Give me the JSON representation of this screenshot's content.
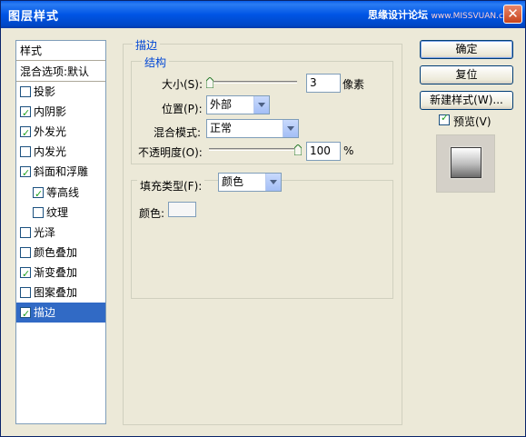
{
  "window": {
    "title": "图层样式",
    "watermark_cn": "思缘设计论坛",
    "watermark_en": "www.MISSVUAN.com",
    "close_glyph": "✕"
  },
  "style_list": {
    "header": "样式",
    "blend_options": "混合选项:默认",
    "items": [
      {
        "label": "投影",
        "checked": false,
        "indent": false,
        "selected": false
      },
      {
        "label": "内阴影",
        "checked": true,
        "indent": false,
        "selected": false
      },
      {
        "label": "外发光",
        "checked": true,
        "indent": false,
        "selected": false
      },
      {
        "label": "内发光",
        "checked": false,
        "indent": false,
        "selected": false
      },
      {
        "label": "斜面和浮雕",
        "checked": true,
        "indent": false,
        "selected": false
      },
      {
        "label": "等高线",
        "checked": true,
        "indent": true,
        "selected": false
      },
      {
        "label": "纹理",
        "checked": false,
        "indent": true,
        "selected": false
      },
      {
        "label": "光泽",
        "checked": false,
        "indent": false,
        "selected": false
      },
      {
        "label": "颜色叠加",
        "checked": false,
        "indent": false,
        "selected": false
      },
      {
        "label": "渐变叠加",
        "checked": true,
        "indent": false,
        "selected": false
      },
      {
        "label": "图案叠加",
        "checked": false,
        "indent": false,
        "selected": false
      },
      {
        "label": "描边",
        "checked": true,
        "indent": false,
        "selected": true
      }
    ]
  },
  "stroke": {
    "section_title": "描边",
    "structure_title": "结构",
    "size_label": "大小(S):",
    "size_value": "3",
    "size_unit": "像素",
    "position_label": "位置(P):",
    "position_value": "外部",
    "blend_label": "混合模式:",
    "blend_value": "正常",
    "opacity_label": "不透明度(O):",
    "opacity_value": "100",
    "opacity_unit": "%",
    "fill_type_label": "填充类型(F):",
    "fill_type_value": "颜色",
    "color_label": "颜色:",
    "color_value": "#f6f6f6"
  },
  "buttons": {
    "ok": "确定",
    "reset": "复位",
    "new_style": "新建样式(W)..."
  },
  "preview": {
    "label": "预览(V)",
    "checked": true
  },
  "colors": {
    "title_bar": "#0055e5",
    "selection": "#316ac5",
    "group_title": "#0046d5"
  }
}
